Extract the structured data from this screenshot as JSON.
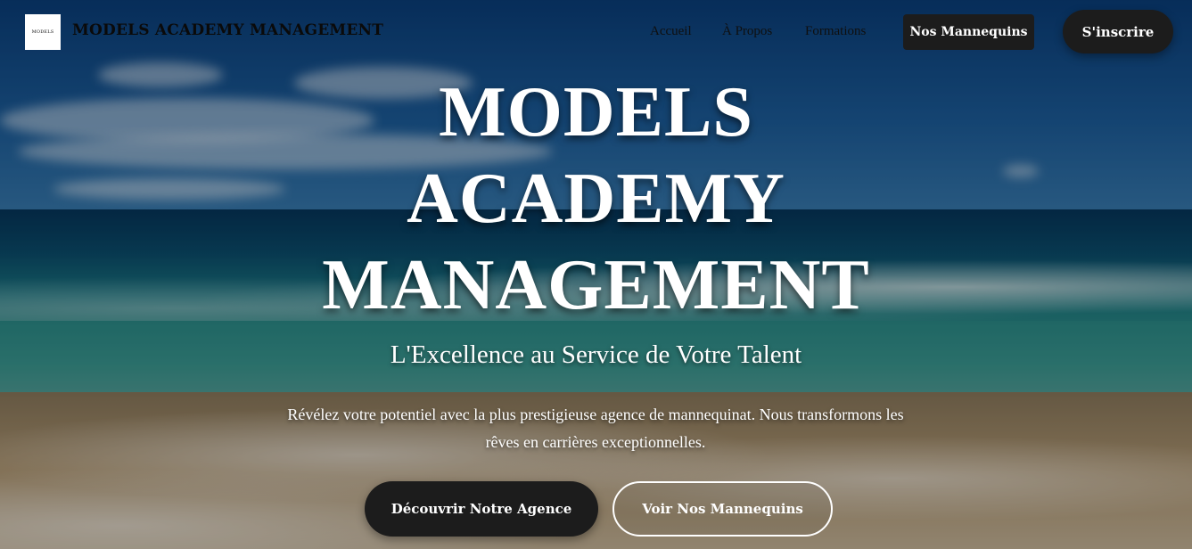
{
  "header": {
    "logo_text": "MODELS",
    "brand": "MODELS ACADEMY MANAGEMENT",
    "nav": [
      {
        "label": "Accueil"
      },
      {
        "label": "À Propos"
      },
      {
        "label": "Formations"
      }
    ],
    "models_button": "Nos Mannequins",
    "signup_button": "S'inscrire"
  },
  "hero": {
    "title_lines": [
      "MODELS",
      "ACADEMY",
      "MANAGEMENT"
    ],
    "subtitle": "L'Excellence au Service de Votre Talent",
    "description": "Révélez votre potentiel avec la plus prestigieuse agence de mannequinat. Nous transformons les rêves en carrières exceptionnelles.",
    "primary_cta": "Découvrir Notre Agence",
    "secondary_cta": "Voir Nos Mannequins"
  },
  "colors": {
    "button_dark": "#1c1c1c",
    "text_light": "#ffffff",
    "header_text": "#0a0a0a"
  }
}
